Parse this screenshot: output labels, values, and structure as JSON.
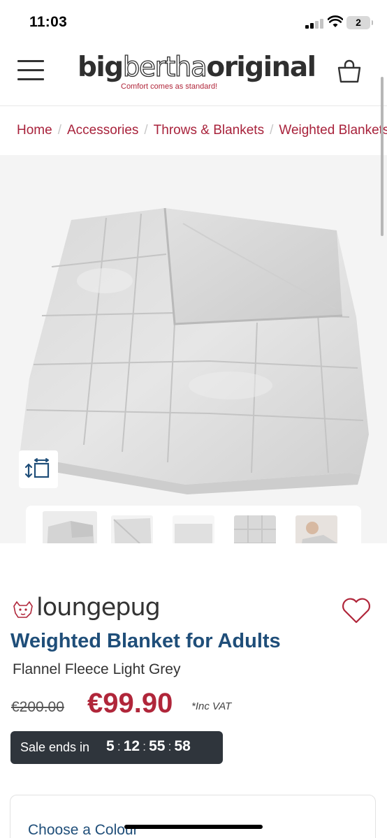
{
  "status_bar": {
    "time": "11:03",
    "battery": "2",
    "icons": [
      "signal-icon",
      "wifi-icon",
      "battery-icon"
    ]
  },
  "header": {
    "logo": {
      "part1": "big",
      "part2": "bertha",
      "part3": "original",
      "tagline": "Comfort comes as standard!"
    },
    "icons": [
      "menu-icon",
      "bag-icon"
    ]
  },
  "breadcrumb": [
    "Home",
    "Accessories",
    "Throws & Blankets",
    "Weighted Blankets"
  ],
  "gallery": {
    "thumbnail_count": 5,
    "active_index": 0,
    "icons": [
      "resize-icon"
    ]
  },
  "product": {
    "brand": "loungepug",
    "title": "Weighted Blanket for Adults",
    "subtitle": "Flannel Fleece Light Grey",
    "price_old": "€200.00",
    "price_now": "€99.90",
    "vat_note": "*Inc VAT",
    "sale": {
      "label": "Sale ends in",
      "days": "5",
      "hours": "12",
      "minutes": "55",
      "seconds": "58"
    },
    "colour_heading": "Choose a Colour"
  },
  "colors": {
    "brand_red": "#b0263a",
    "title_blue": "#1f4e79",
    "sale_bar": "#2f353c"
  }
}
